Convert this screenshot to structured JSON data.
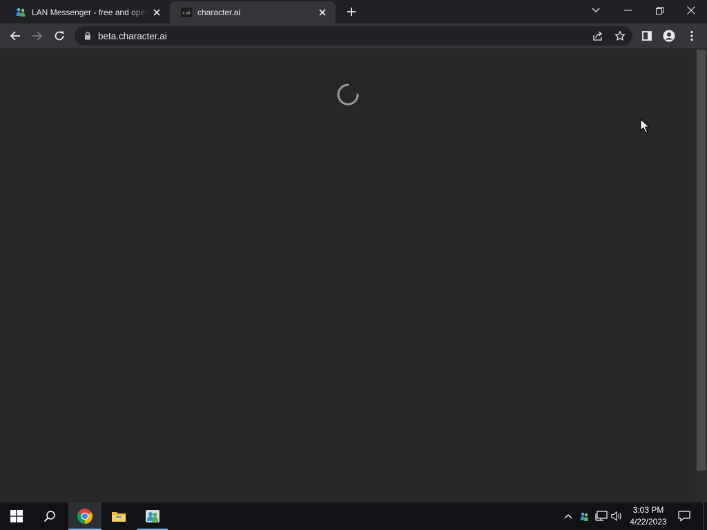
{
  "browser": {
    "tabs": [
      {
        "title": "LAN Messenger - free and open",
        "favicon": "lan-messenger-icon",
        "active": false
      },
      {
        "title": "character.ai",
        "favicon": "character-ai-icon",
        "favicon_text": "c.ai",
        "active": true
      }
    ],
    "address_bar": {
      "url": "beta.character.ai",
      "secure": true
    },
    "colors": {
      "frame": "#202124",
      "toolbar": "#35363a",
      "content": "#262727"
    }
  },
  "page": {
    "state": "loading",
    "spinner": "loading-spinner-icon"
  },
  "taskbar": {
    "apps": [
      "start-icon",
      "search-icon",
      "chrome-icon",
      "file-explorer-icon",
      "lan-messenger-icon"
    ],
    "clock": {
      "time": "3:03 PM",
      "date": "4/22/2023"
    },
    "accent": "#76b9ed"
  }
}
